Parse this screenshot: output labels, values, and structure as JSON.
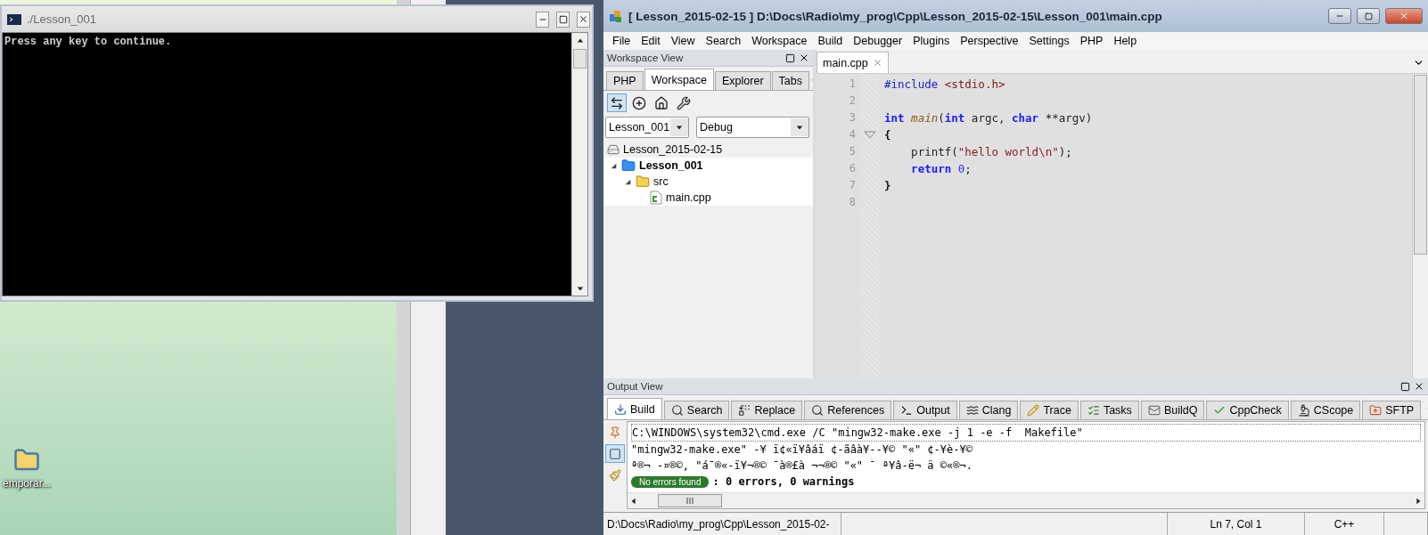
{
  "desktop": {
    "icon_label": "emporar..."
  },
  "console": {
    "title": "./Lesson_001",
    "lines": [
      "Press any key to continue."
    ]
  },
  "ide": {
    "title": "[ Lesson_2015-02-15 ] D:\\Docs\\Radio\\my_prog\\Cpp\\Lesson_2015-02-15\\Lesson_001\\main.cpp",
    "menu": [
      "File",
      "Edit",
      "View",
      "Search",
      "Workspace",
      "Build",
      "Debugger",
      "Plugins",
      "Perspective",
      "Settings",
      "PHP",
      "Help"
    ],
    "workspace_view": {
      "title": "Workspace View",
      "tabs": [
        {
          "label": "PHP",
          "selected": false
        },
        {
          "label": "Workspace",
          "selected": true
        },
        {
          "label": "Explorer",
          "selected": false
        },
        {
          "label": "Tabs",
          "selected": false
        }
      ],
      "toolbar": [
        {
          "kind": "link",
          "selected": true
        },
        {
          "kind": "add",
          "selected": false
        },
        {
          "kind": "home",
          "selected": false
        },
        {
          "kind": "settings",
          "selected": false
        }
      ],
      "project_select": "Lesson_001",
      "config_select": "Debug",
      "tree": [
        {
          "label": "Lesson_2015-02-15",
          "kind": "workspace",
          "children": [
            {
              "label": "Lesson_001",
              "kind": "project",
              "expanded": true,
              "children": [
                {
                  "label": "src",
                  "kind": "folder",
                  "expanded": true,
                  "children": [
                    {
                      "label": "main.cpp",
                      "kind": "file"
                    }
                  ]
                }
              ]
            }
          ]
        }
      ]
    },
    "editor": {
      "tabs": [
        {
          "label": "main.cpp",
          "selected": true
        }
      ],
      "lines": [
        {
          "number": "1",
          "fold": false,
          "tokens": [
            {
              "t": "#include",
              "kind": "preprocessor"
            },
            {
              "t": " <stdio.h>",
              "kind": "header"
            }
          ]
        },
        {
          "number": "2",
          "fold": false
        },
        {
          "number": "3",
          "fold": false,
          "tokens": [
            {
              "t": "int",
              "kind": "keyword"
            },
            {
              "t": " main",
              "kind": "function"
            },
            {
              "t": "(",
              "kind": "plain"
            },
            {
              "t": "int",
              "kind": "keyword"
            },
            {
              "t": " argc, ",
              "kind": "plain"
            },
            {
              "t": "char",
              "kind": "keyword"
            },
            {
              "t": " **argv)",
              "kind": "plain"
            }
          ]
        },
        {
          "number": "4",
          "fold": true,
          "tokens": [
            {
              "t": "{",
              "kind": "brace"
            }
          ]
        },
        {
          "number": "5",
          "fold": false,
          "tokens": [
            {
              "t": "    printf(",
              "kind": "plain"
            },
            {
              "t": "\"hello world\\n\"",
              "kind": "string"
            },
            {
              "t": ");",
              "kind": "plain"
            }
          ]
        },
        {
          "number": "6",
          "fold": false,
          "tokens": [
            {
              "t": "    return ",
              "kind": "keyword"
            },
            {
              "t": "0",
              "kind": "number"
            },
            {
              "t": ";",
              "kind": "plain"
            }
          ]
        },
        {
          "number": "7",
          "fold": false,
          "tokens": [
            {
              "t": "}",
              "kind": "brace"
            }
          ]
        },
        {
          "number": "8",
          "fold": false
        }
      ]
    },
    "output_view": {
      "title": "Output View",
      "tabs": [
        {
          "label": "Build",
          "kind": "download",
          "selected": true
        },
        {
          "label": "Search",
          "kind": "search",
          "selected": false
        },
        {
          "label": "Replace",
          "kind": "replace",
          "selected": false
        },
        {
          "label": "References",
          "kind": "search",
          "selected": false
        },
        {
          "label": "Output",
          "kind": "terminal",
          "selected": false
        },
        {
          "label": "Clang",
          "kind": "clang",
          "selected": false
        },
        {
          "label": "Trace",
          "kind": "pencil",
          "selected": false
        },
        {
          "label": "Tasks",
          "kind": "tasks",
          "selected": false
        },
        {
          "label": "BuildQ",
          "kind": "mail",
          "selected": false
        },
        {
          "label": "CppCheck",
          "kind": "check",
          "selected": false
        },
        {
          "label": "CScope",
          "kind": "microscope",
          "selected": false
        },
        {
          "label": "SFTP",
          "kind": "sftp",
          "selected": false
        }
      ],
      "side_buttons": [
        {
          "kind": "pin",
          "selected": false
        },
        {
          "kind": "scroll",
          "selected": true
        },
        {
          "kind": "clear",
          "selected": false
        }
      ],
      "lines": [
        {
          "kind": "command",
          "text": "C:\\WINDOWS\\system32\\cmd.exe /C \"mingw32-make.exe -j 1 -e -f  Makefile\""
        },
        {
          "kind": "plain",
          "text": "\"mingw32-make.exe\" -¥ ï¢«ï¥âáï ¢-ãâà¥--¥© \"«\" ¢-¥è-¥©"
        },
        {
          "kind": "plain",
          "text": "ª®¬ -¤®©, \"á¯®«-ï¥¬®© ¯à®£à ¬¬®© \"«\" ¯ ª¥â-ë¬ ä ©«®¬."
        },
        {
          "kind": "summary",
          "badge": "No errors found",
          "text": ": 0 errors, 0 warnings"
        }
      ]
    },
    "status_bar": {
      "path": "D:\\Docs\\Radio\\my_prog\\Cpp\\Lesson_2015-02-",
      "position": "Ln 7, Col 1",
      "language": "C++"
    }
  }
}
